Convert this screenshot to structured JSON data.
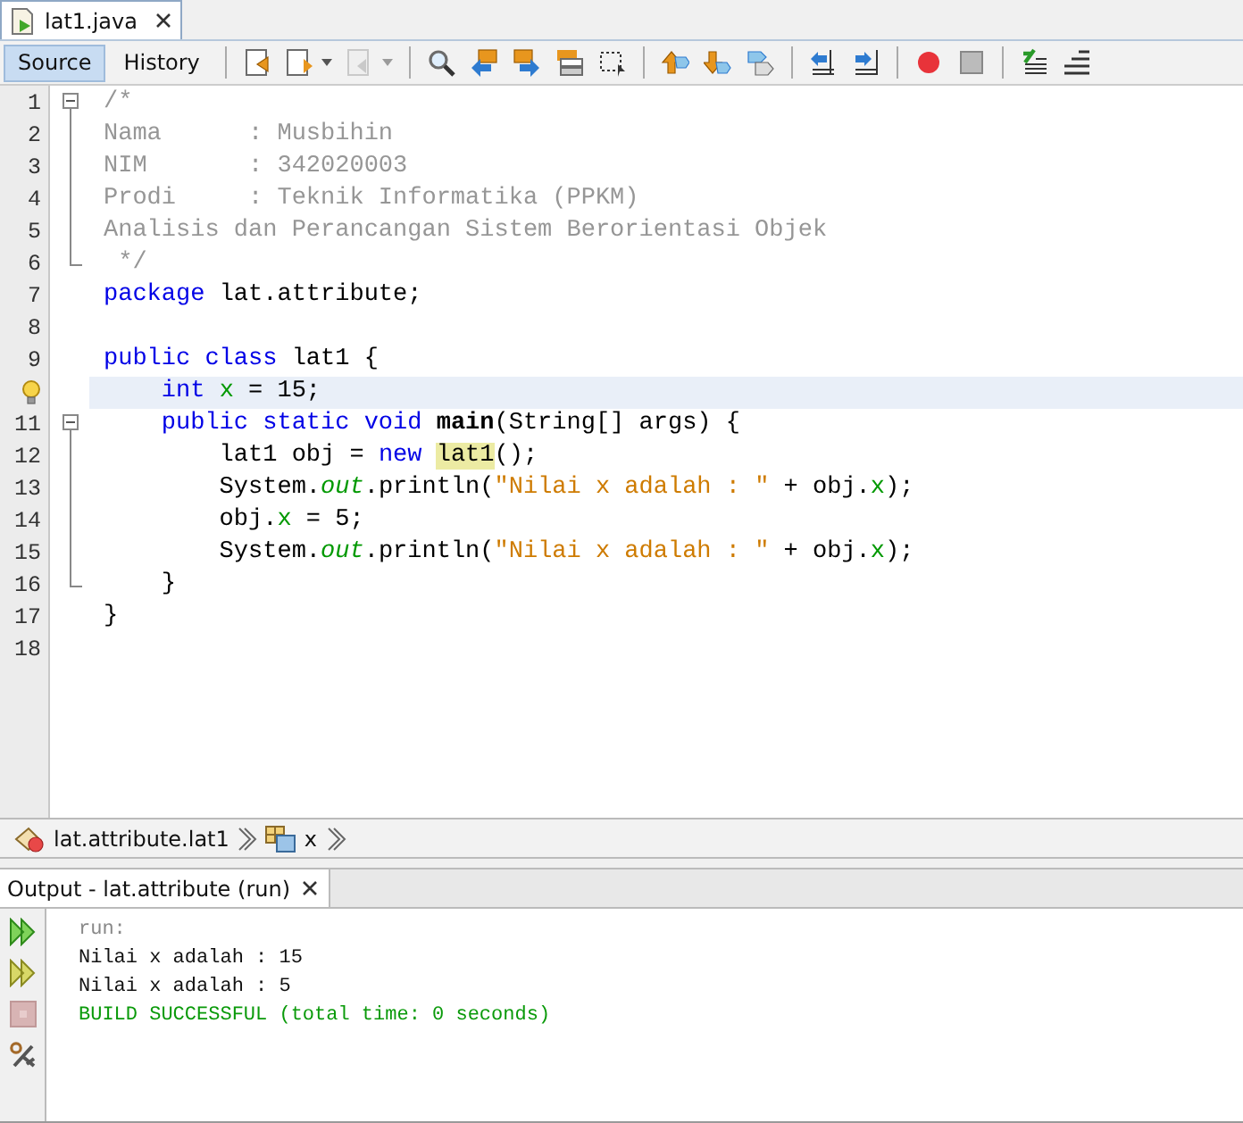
{
  "file_tab": {
    "title": "lat1.java",
    "selected": true
  },
  "view_tabs": [
    {
      "label": "Source",
      "selected": true
    },
    {
      "label": "History",
      "selected": false
    }
  ],
  "toolbar_groups": [
    [
      {
        "kind": "last-edit",
        "disabled": false,
        "dropdown": false
      },
      {
        "kind": "back",
        "disabled": false,
        "dropdown": true
      },
      {
        "kind": "forward",
        "disabled": true,
        "dropdown": true
      }
    ],
    [
      {
        "kind": "find",
        "disabled": false,
        "dropdown": false
      },
      {
        "kind": "find-prev",
        "disabled": false,
        "dropdown": false
      },
      {
        "kind": "find-next",
        "disabled": false,
        "dropdown": false
      },
      {
        "kind": "highlight",
        "disabled": false,
        "dropdown": false
      },
      {
        "kind": "rect-select",
        "disabled": false,
        "dropdown": false
      }
    ],
    [
      {
        "kind": "prev-bookmark",
        "disabled": false,
        "dropdown": false
      },
      {
        "kind": "next-bookmark",
        "disabled": false,
        "dropdown": false
      },
      {
        "kind": "toggle-bookmark",
        "disabled": false,
        "dropdown": false
      }
    ],
    [
      {
        "kind": "shift-left",
        "disabled": false,
        "dropdown": false
      },
      {
        "kind": "shift-right",
        "disabled": false,
        "dropdown": false
      }
    ],
    [
      {
        "kind": "record",
        "disabled": false,
        "dropdown": false
      },
      {
        "kind": "stop",
        "disabled": false,
        "dropdown": false
      }
    ],
    [
      {
        "kind": "comment",
        "disabled": false,
        "dropdown": false
      },
      {
        "kind": "uncomment",
        "disabled": false,
        "dropdown": false
      }
    ]
  ],
  "code_lines": [
    {
      "number": "1",
      "kind": "fold-start",
      "highlighted": false,
      "hint": false,
      "tokens": [
        {
          "text": "/*",
          "kind": "comment"
        }
      ]
    },
    {
      "number": "2",
      "kind": "fold-body",
      "highlighted": false,
      "hint": false,
      "tokens": [
        {
          "text": "Nama      : Musbihin",
          "kind": "comment"
        }
      ]
    },
    {
      "number": "3",
      "kind": "fold-body",
      "highlighted": false,
      "hint": false,
      "tokens": [
        {
          "text": "NIM       : 342020003",
          "kind": "comment"
        }
      ]
    },
    {
      "number": "4",
      "kind": "fold-body",
      "highlighted": false,
      "hint": false,
      "tokens": [
        {
          "text": "Prodi     : Teknik Informatika (PPKM)",
          "kind": "comment"
        }
      ]
    },
    {
      "number": "5",
      "kind": "fold-body",
      "highlighted": false,
      "hint": false,
      "tokens": [
        {
          "text": "Analisis dan Perancangan Sistem Berorientasi Objek",
          "kind": "comment"
        }
      ]
    },
    {
      "number": "6",
      "kind": "fold-end",
      "highlighted": false,
      "hint": false,
      "tokens": [
        {
          "text": " */",
          "kind": "comment"
        }
      ]
    },
    {
      "number": "7",
      "kind": "plain",
      "highlighted": false,
      "hint": false,
      "tokens": [
        {
          "text": "package ",
          "kind": "keyword"
        },
        {
          "text": "lat.attribute;",
          "kind": "plain"
        }
      ]
    },
    {
      "number": "8",
      "kind": "plain",
      "highlighted": false,
      "hint": false
    },
    {
      "number": "9",
      "kind": "plain",
      "highlighted": false,
      "hint": false,
      "tokens": [
        {
          "text": "public class ",
          "kind": "keyword"
        },
        {
          "text": "lat1 {",
          "kind": "plain"
        }
      ]
    },
    {
      "kind": "plain",
      "highlighted": true,
      "hint": true,
      "tokens": [
        {
          "text": "    int ",
          "kind": "keyword"
        },
        {
          "text": "x",
          "kind": "field"
        },
        {
          "text": " = 15;",
          "kind": "plain"
        }
      ]
    },
    {
      "number": "11",
      "kind": "fold-start",
      "highlighted": false,
      "hint": false,
      "tokens": [
        {
          "text": "    public static void ",
          "kind": "keyword"
        },
        {
          "text": "main",
          "kind": "method"
        },
        {
          "text": "(String[] args) {",
          "kind": "plain"
        }
      ]
    },
    {
      "number": "12",
      "kind": "fold-body",
      "highlighted": false,
      "hint": false,
      "tokens": [
        {
          "text": "        lat1 obj = ",
          "kind": "plain"
        },
        {
          "text": "new ",
          "kind": "keyword"
        },
        {
          "text": "lat1",
          "kind": "match"
        },
        {
          "text": "();",
          "kind": "plain"
        }
      ]
    },
    {
      "number": "13",
      "kind": "fold-body",
      "highlighted": false,
      "hint": false,
      "tokens": [
        {
          "text": "        System.",
          "kind": "plain"
        },
        {
          "text": "out",
          "kind": "static"
        },
        {
          "text": ".println(",
          "kind": "plain"
        },
        {
          "text": "\"Nilai x adalah : \"",
          "kind": "string"
        },
        {
          "text": " + obj.",
          "kind": "plain"
        },
        {
          "text": "x",
          "kind": "field"
        },
        {
          "text": ");",
          "kind": "plain"
        }
      ]
    },
    {
      "number": "14",
      "kind": "fold-body",
      "highlighted": false,
      "hint": false,
      "tokens": [
        {
          "text": "        obj.",
          "kind": "plain"
        },
        {
          "text": "x",
          "kind": "field"
        },
        {
          "text": " = 5;",
          "kind": "plain"
        }
      ]
    },
    {
      "number": "15",
      "kind": "fold-body",
      "highlighted": false,
      "hint": false,
      "tokens": [
        {
          "text": "        System.",
          "kind": "plain"
        },
        {
          "text": "out",
          "kind": "static"
        },
        {
          "text": ".println(",
          "kind": "plain"
        },
        {
          "text": "\"Nilai x adalah : \"",
          "kind": "string"
        },
        {
          "text": " + obj.",
          "kind": "plain"
        },
        {
          "text": "x",
          "kind": "field"
        },
        {
          "text": ");",
          "kind": "plain"
        }
      ]
    },
    {
      "number": "16",
      "kind": "fold-end",
      "highlighted": false,
      "hint": false,
      "tokens": [
        {
          "text": "    }",
          "kind": "plain"
        }
      ]
    },
    {
      "number": "17",
      "kind": "plain",
      "highlighted": false,
      "hint": false,
      "tokens": [
        {
          "text": "}",
          "kind": "plain"
        }
      ]
    },
    {
      "number": "18",
      "kind": "plain",
      "highlighted": false,
      "hint": false
    }
  ],
  "breadcrumbs": [
    {
      "label": "lat.attribute.lat1",
      "kind": "class"
    },
    {
      "label": "x",
      "kind": "field"
    }
  ],
  "output_tab": {
    "title": "Output - lat.attribute (run)",
    "selected": true
  },
  "output_tools": [
    {
      "kind": "rerun",
      "disabled": false
    },
    {
      "kind": "rerun-options",
      "disabled": false
    },
    {
      "kind": "stop",
      "disabled": true
    },
    {
      "kind": "settings",
      "disabled": false
    }
  ],
  "output_lines": [
    {
      "text": "run:",
      "kind": "info"
    },
    {
      "text": "Nilai x adalah : 15",
      "kind": "plain"
    },
    {
      "text": "Nilai x adalah : 5",
      "kind": "plain"
    },
    {
      "text": "BUILD SUCCESSFUL (total time: 0 seconds)",
      "kind": "success"
    }
  ]
}
